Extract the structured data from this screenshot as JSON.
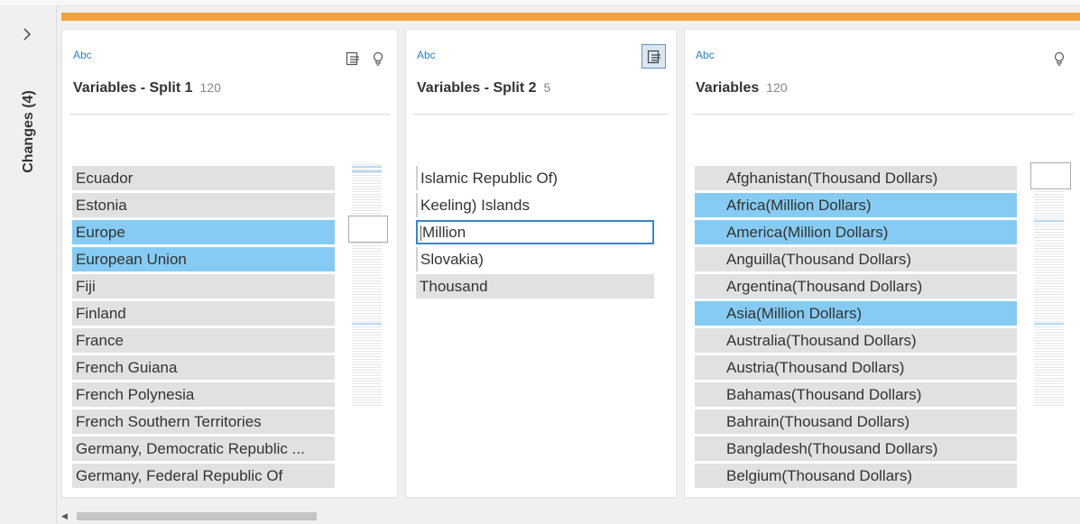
{
  "sidebar": {
    "expand_icon": "chevron-right-icon",
    "changes_label": "Changes (4)"
  },
  "colors": {
    "accent_bar": "#f4a23e",
    "selected_row": "#86cbf3",
    "type_tag": "#2e7fbf"
  },
  "cards": [
    {
      "type": "Abc",
      "title": "Variables - Split 1",
      "count": "120",
      "icons": [
        "split-icon",
        "recommendation-bulb-icon"
      ],
      "rows": [
        {
          "label": "Ecuador",
          "selected": false
        },
        {
          "label": "Estonia",
          "selected": false
        },
        {
          "label": "Europe",
          "selected": true
        },
        {
          "label": "European Union",
          "selected": true
        },
        {
          "label": "Fiji",
          "selected": false
        },
        {
          "label": "Finland",
          "selected": false
        },
        {
          "label": "France",
          "selected": false
        },
        {
          "label": "French Guiana",
          "selected": false
        },
        {
          "label": "French Polynesia",
          "selected": false
        },
        {
          "label": "French Southern Territories",
          "selected": false
        },
        {
          "label": "Germany, Democratic Republic ...",
          "selected": false
        },
        {
          "label": "Germany, Federal Republic Of",
          "selected": false
        }
      ]
    },
    {
      "type": "Abc",
      "title": "Variables - Split 2",
      "count": "5",
      "icons": [
        "split-icon-active"
      ],
      "rows": [
        {
          "label": "Islamic Republic Of)",
          "selected": false
        },
        {
          "label": "Keeling) Islands",
          "selected": false
        },
        {
          "label": "Million",
          "selected": false,
          "editing": true
        },
        {
          "label": "Slovakia)",
          "selected": false
        },
        {
          "label": "Thousand",
          "selected": false
        }
      ]
    },
    {
      "type": "Abc",
      "title": "Variables",
      "count": "120",
      "icons": [
        "recommendation-bulb-icon"
      ],
      "rows": [
        {
          "label": "Afghanistan(Thousand Dollars)",
          "selected": false
        },
        {
          "label": "Africa(Million Dollars)",
          "selected": true
        },
        {
          "label": "America(Million Dollars)",
          "selected": true
        },
        {
          "label": "Anguilla(Thousand Dollars)",
          "selected": false
        },
        {
          "label": "Argentina(Thousand Dollars)",
          "selected": false
        },
        {
          "label": "Asia(Million Dollars)",
          "selected": true
        },
        {
          "label": "Australia(Thousand Dollars)",
          "selected": false
        },
        {
          "label": "Austria(Thousand Dollars)",
          "selected": false
        },
        {
          "label": "Bahamas(Thousand Dollars)",
          "selected": false
        },
        {
          "label": "Bahrain(Thousand Dollars)",
          "selected": false
        },
        {
          "label": "Bangladesh(Thousand Dollars)",
          "selected": false
        },
        {
          "label": "Belgium(Thousand Dollars)",
          "selected": false
        }
      ]
    }
  ]
}
